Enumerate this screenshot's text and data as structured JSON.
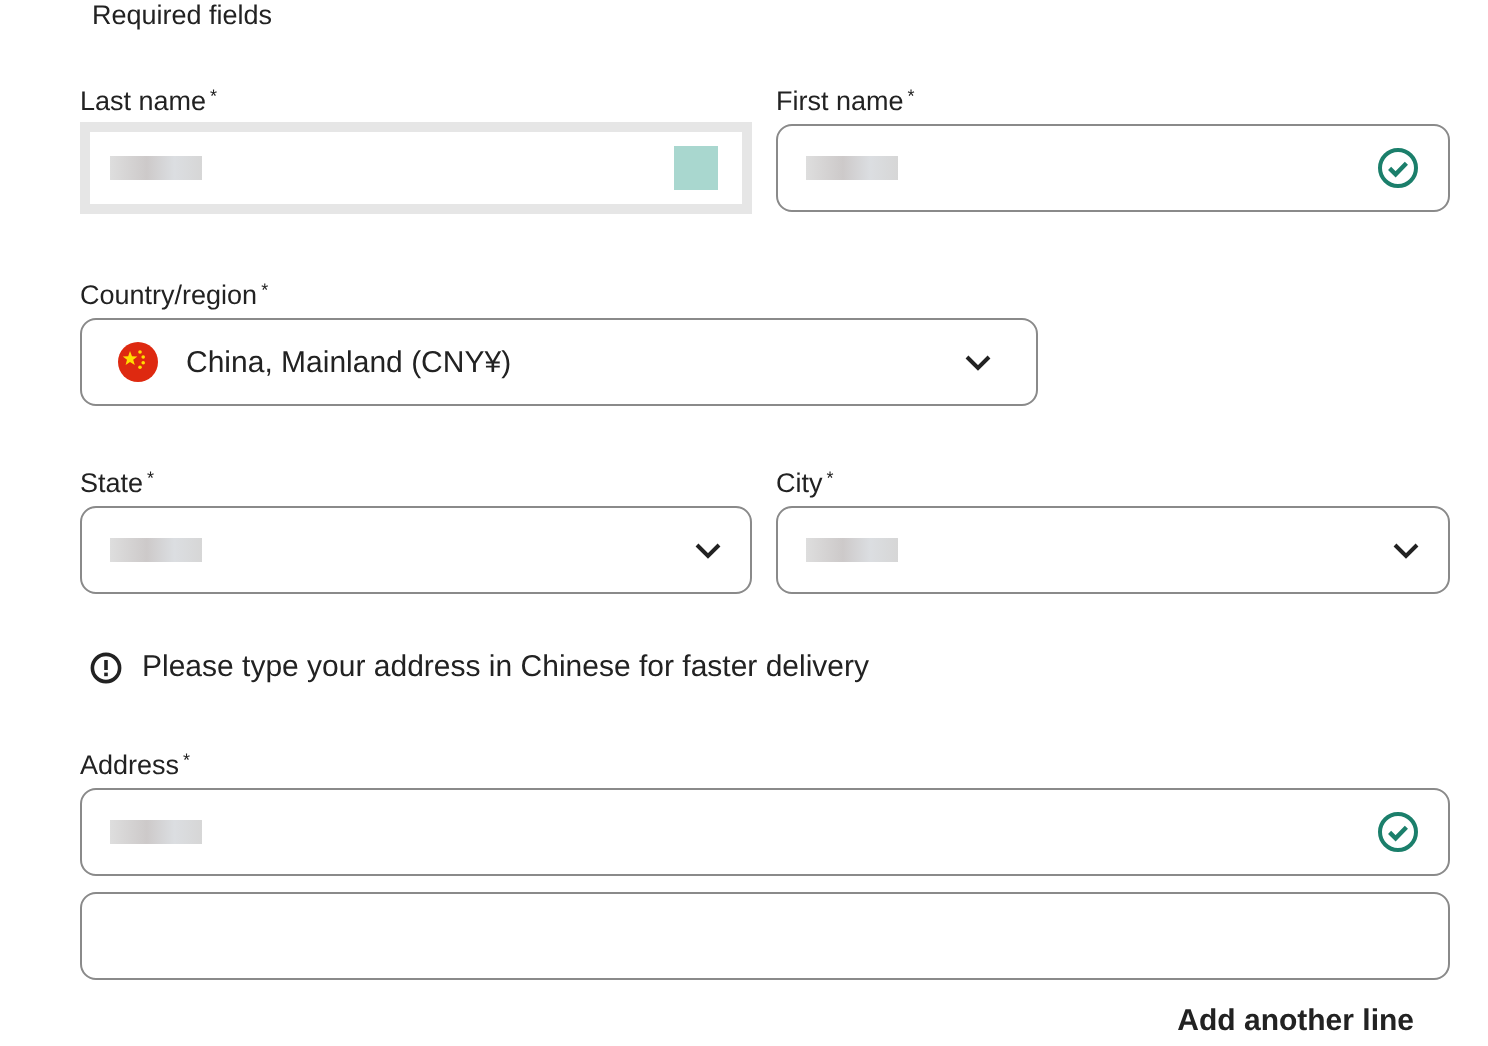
{
  "required_note": "Required fields",
  "name_fields": [
    {
      "label": "Last name$^{*}$",
      "focused": true,
      "valid": true,
      "filled": true
    },
    {
      "label": "First name$^{*}$",
      "focused": false,
      "valid": true,
      "filled": true
    }
  ],
  "country": {
    "label": "Country/region$^{*}$",
    "value": "China, Mainland (CNY¥)"
  },
  "location_fields": [
    {
      "label": "State$^{*}$",
      "focused": false,
      "valid": false,
      "filled": true
    },
    {
      "label": "City$^{*}$",
      "focused": false,
      "valid": false,
      "filled": true
    }
  ],
  "notice": "Please type your address in Chinese for faster delivery",
  "address": {
    "label": "Address$^{*}$",
    "lines": [
      {
        "focused": false,
        "valid": true,
        "filled": true
      },
      {
        "focused": false,
        "valid": false,
        "filled": false
      }
    ]
  },
  "add_line_link": "Add another line"
}
